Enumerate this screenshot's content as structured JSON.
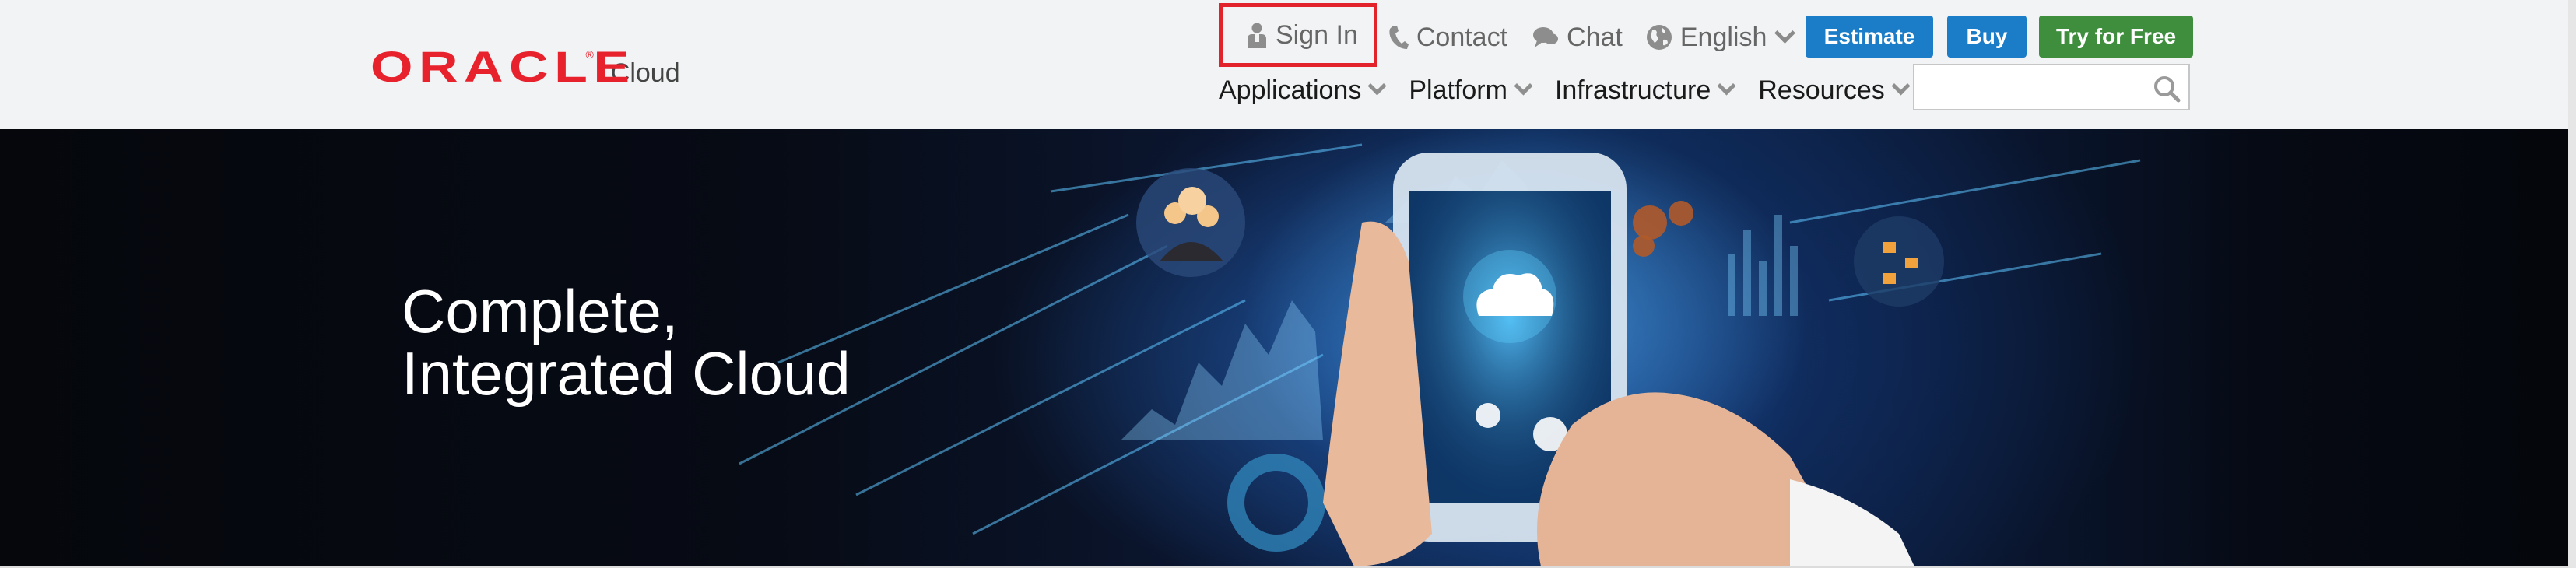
{
  "brand": {
    "logo_word": "ORACLE",
    "logo_reg": "®",
    "logo_product": "Cloud",
    "color": "#e8222d"
  },
  "utility_nav": {
    "sign_in": "Sign In",
    "contact": "Contact",
    "chat": "Chat",
    "language": "English"
  },
  "actions": {
    "estimate": "Estimate",
    "buy": "Buy",
    "try_free": "Try for Free"
  },
  "main_nav": [
    {
      "label": "Applications"
    },
    {
      "label": "Platform"
    },
    {
      "label": "Infrastructure"
    },
    {
      "label": "Resources"
    }
  ],
  "search": {
    "value": "",
    "placeholder": ""
  },
  "hero": {
    "title_line1": "Complete,",
    "title_line2": "Integrated Cloud"
  },
  "colors": {
    "header_bg": "#f2f3f4",
    "primary_button": "#1b7cc7",
    "cta_button": "#3f8e3e",
    "highlight_box": "#e2232b"
  },
  "icons": {
    "sign_in": "user-icon",
    "contact": "phone-icon",
    "chat": "chat-bubble-icon",
    "language": "globe-icon",
    "search": "search-icon"
  }
}
